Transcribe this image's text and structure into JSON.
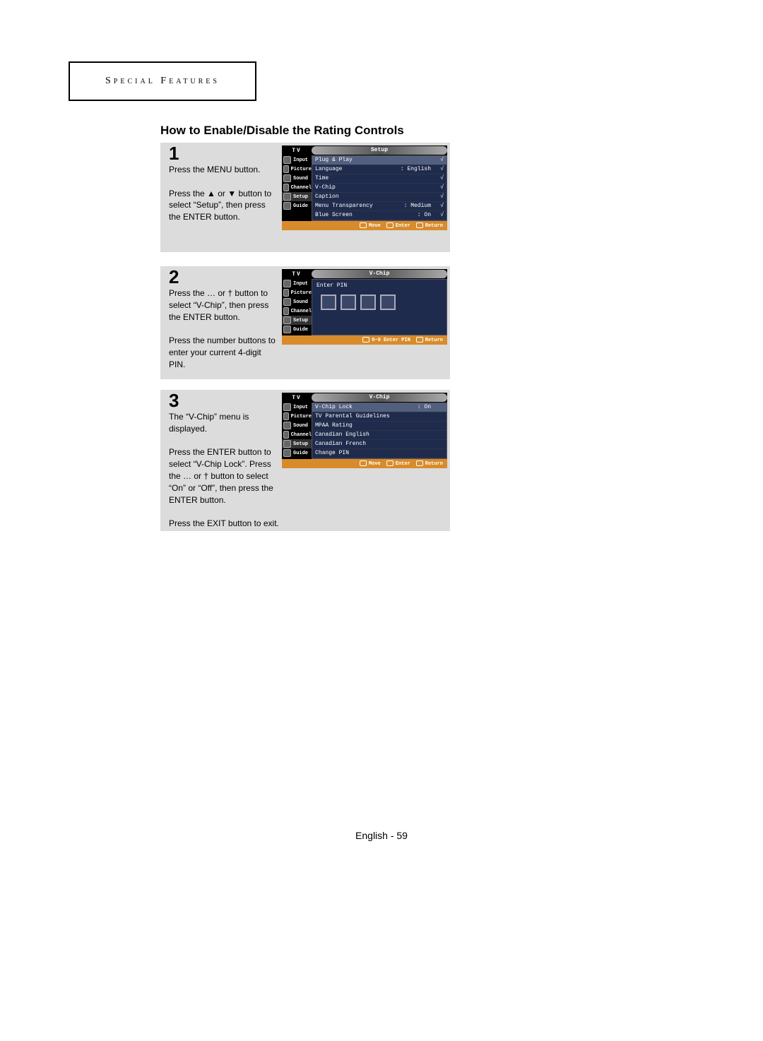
{
  "header": {
    "section_title": "Special Features"
  },
  "heading": "How to Enable/Disable the Rating Controls",
  "steps": {
    "1": {
      "num": "1",
      "para1": "Press the MENU button.",
      "para2": "Press the ▲ or ▼ button to select “Setup”, then press the ENTER button."
    },
    "2": {
      "num": "2",
      "para1": "Press the … or † button to select “V-Chip”, then press the ENTER button.",
      "para2": "Press the number buttons to enter your current 4-digit PIN."
    },
    "3": {
      "num": "3",
      "para1": "The “V-Chip” menu is displayed.",
      "para2": "Press the ENTER button to select “V-Chip Lock”. Press the … or † button to select “On” or “Off”, then press the ENTER button.",
      "para3": "Press the EXIT button to exit."
    }
  },
  "osd": {
    "tv": "TV",
    "side": [
      "Input",
      "Picture",
      "Sound",
      "Channel",
      "Setup",
      "Guide"
    ],
    "screen1": {
      "title": "Setup",
      "rows": [
        {
          "l": "Plug & Play",
          "m": "",
          "r": "√"
        },
        {
          "l": "Language",
          "m": ": English",
          "r": "√"
        },
        {
          "l": "Time",
          "m": "",
          "r": "√"
        },
        {
          "l": "V-Chip",
          "m": "",
          "r": "√"
        },
        {
          "l": "Caption",
          "m": "",
          "r": "√"
        },
        {
          "l": "Menu Transparency",
          "m": ": Medium",
          "r": "√"
        },
        {
          "l": "Blue Screen",
          "m": ": On",
          "r": "√"
        }
      ],
      "foot": [
        "Move",
        "Enter",
        "Return"
      ]
    },
    "screen2": {
      "title": "V-Chip",
      "label": "Enter PIN",
      "foot": [
        "0~9 Enter PIN",
        "Return"
      ]
    },
    "screen3": {
      "title": "V-Chip",
      "rows": [
        {
          "l": "V-Chip Lock",
          "m": ": On",
          "r": ""
        },
        {
          "l": "TV Parental Guidelines",
          "m": "",
          "r": ""
        },
        {
          "l": "MPAA Rating",
          "m": "",
          "r": ""
        },
        {
          "l": "Canadian English",
          "m": "",
          "r": ""
        },
        {
          "l": "Canadian French",
          "m": "",
          "r": ""
        },
        {
          "l": "Change PIN",
          "m": "",
          "r": ""
        }
      ],
      "foot": [
        "Move",
        "Enter",
        "Return"
      ]
    }
  },
  "footer": "English - 59"
}
